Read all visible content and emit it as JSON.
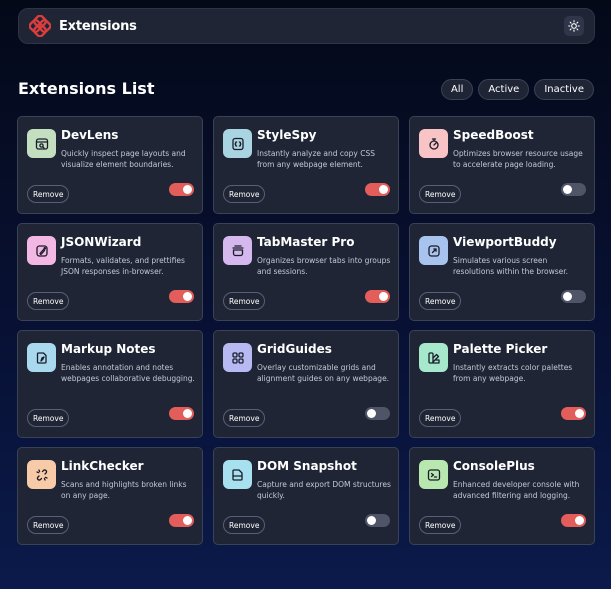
{
  "header": {
    "title": "Extensions",
    "logo_icon": "extensions-logo-icon",
    "theme_icon": "sun-icon",
    "brand_color": "#d93d3d"
  },
  "list": {
    "title": "Extensions List"
  },
  "filters": [
    {
      "label": "All",
      "name": "all"
    },
    {
      "label": "Active",
      "name": "active"
    },
    {
      "label": "Inactive",
      "name": "inactive"
    }
  ],
  "remove_label": "Remove",
  "extensions": [
    {
      "name": "DevLens",
      "description": "Quickly inspect page layouts and visualize element boundaries.",
      "active": true,
      "icon": "devlens-icon",
      "icon_bg": "#c3dfc0"
    },
    {
      "name": "StyleSpy",
      "description": "Instantly analyze and copy CSS from any webpage element.",
      "active": true,
      "icon": "stylespy-icon",
      "icon_bg": "#a9d4e2"
    },
    {
      "name": "SpeedBoost",
      "description": "Optimizes browser resource usage to accelerate page loading.",
      "active": false,
      "icon": "speedboost-icon",
      "icon_bg": "#f9c4c6"
    },
    {
      "name": "JSONWizard",
      "description": "Formats, validates, and prettifies JSON responses in-browser.",
      "active": true,
      "icon": "jsonwizard-icon",
      "icon_bg": "#f2b7e2"
    },
    {
      "name": "TabMaster Pro",
      "description": "Organizes browser tabs into groups and sessions.",
      "active": true,
      "icon": "tabmaster-icon",
      "icon_bg": "#d5b8ee"
    },
    {
      "name": "ViewportBuddy",
      "description": "Simulates various screen resolutions within the browser.",
      "active": false,
      "icon": "viewportbuddy-icon",
      "icon_bg": "#a9c3ef"
    },
    {
      "name": "Markup Notes",
      "description": "Enables annotation and notes webpages collaborative debugging.",
      "active": true,
      "icon": "markup-notes-icon",
      "icon_bg": "#a9d9ef"
    },
    {
      "name": "GridGuides",
      "description": "Overlay customizable grids and alignment guides on any webpage.",
      "active": false,
      "icon": "gridguides-icon",
      "icon_bg": "#b6b9f2"
    },
    {
      "name": "Palette Picker",
      "description": "Instantly extracts color palettes from any webpage.",
      "active": true,
      "icon": "palette-picker-icon",
      "icon_bg": "#a6e8cc"
    },
    {
      "name": "LinkChecker",
      "description": "Scans and highlights broken links on any page.",
      "active": true,
      "icon": "linkchecker-icon",
      "icon_bg": "#f8cba8"
    },
    {
      "name": "DOM Snapshot",
      "description": "Capture and export DOM structures quickly.",
      "active": false,
      "icon": "dom-snapshot-icon",
      "icon_bg": "#a7e1ef"
    },
    {
      "name": "ConsolePlus",
      "description": "Enhanced developer console with advanced filtering and logging.",
      "active": true,
      "icon": "consoleplus-icon",
      "icon_bg": "#b9e7b0"
    }
  ]
}
